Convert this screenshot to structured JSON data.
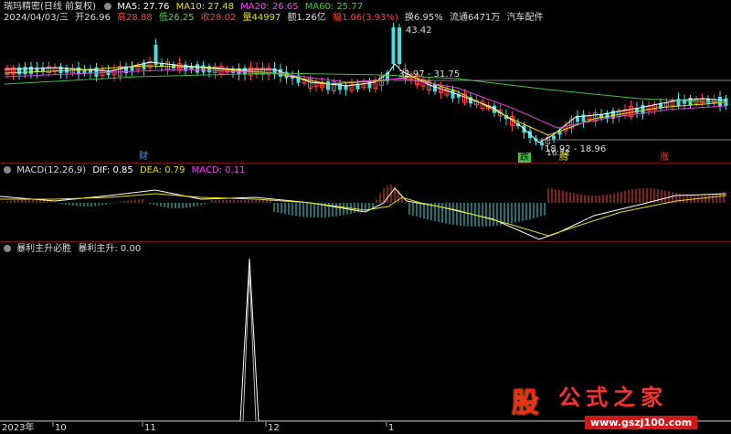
{
  "header": {
    "title": "瑞玛精密(日线 前复权)",
    "ma5": "MA5: 27.76",
    "ma10": "MA10: 27.48",
    "ma20": "MA20: 26.65",
    "ma60": "MA60: 25.77"
  },
  "info": {
    "date": "2024/04/03/三",
    "open": "开26.96",
    "high": "高28.88",
    "low": "低26.25",
    "close": "收28.02",
    "volume": "量44997",
    "amount": "额1.26亿",
    "amplitude": "幅1.06(3.93%)",
    "turnover": "换6.95%",
    "float": "流通6471万",
    "sector": "汽车配件"
  },
  "price_labels": {
    "high": "43.42",
    "mid": "32.97 - 31.75",
    "low_range": "18.92 - 18.96",
    "low": "16.72"
  },
  "markers": {
    "cai": "财",
    "die": "跌",
    "teng": "腾",
    "zhang": "涨"
  },
  "macd": {
    "label": "MACD(12,26,9)",
    "dif": "DIF: 0.85",
    "dea": "DEA: 0.79",
    "macd": "MACD: 0.11"
  },
  "indicator": {
    "name": "暴利主升必胜",
    "value": "暴利主升: 0.00"
  },
  "axis": [
    "2023年",
    "10",
    "11",
    "12",
    "1"
  ],
  "watermark": {
    "logo": "股",
    "text": "公式之家",
    "url": "www.gszj100.com"
  },
  "colors": {
    "ma5": "#ffffff",
    "ma10": "#e8e000",
    "ma20": "#e040e0",
    "ma60": "#40c040",
    "up": "#ff4040",
    "down": "#40e0e0",
    "separator": "#7a1010"
  }
}
